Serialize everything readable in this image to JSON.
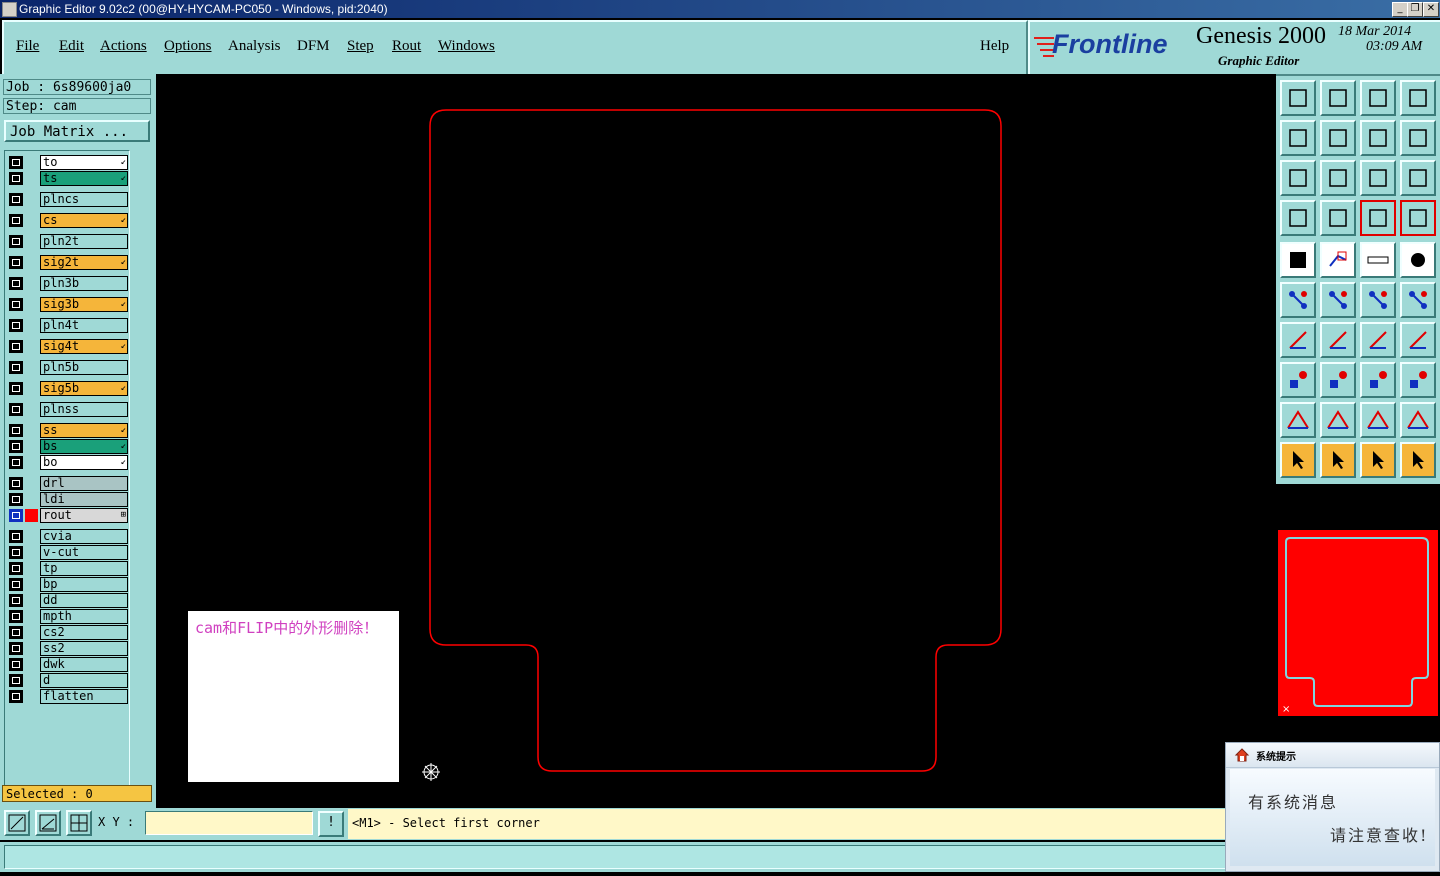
{
  "window": {
    "title": "Graphic Editor 9.02c2 (00@HY-HYCAM-PC050 - Windows, pid:2040)",
    "minimize": "_",
    "restore": "❐",
    "close": "✕"
  },
  "menu": {
    "items": [
      "File",
      "Edit",
      "Actions",
      "Options",
      "Analysis",
      "DFM",
      "Step",
      "Rout",
      "Windows"
    ],
    "help": "Help"
  },
  "brand": {
    "logo": "Frontline",
    "product": "Genesis 2000",
    "subtitle": "Graphic Editor",
    "date": "18 Mar 2014",
    "time": "03:09 AM"
  },
  "job": {
    "job_label": "Job : 6s89600ja0",
    "step_label": "Step: cam",
    "matrix_button": "Job Matrix ..."
  },
  "layers": [
    {
      "name": "to",
      "color": "#ffffff",
      "mark": "↙"
    },
    {
      "name": "ts",
      "color": "#1aa07a",
      "mark": "↙"
    },
    {
      "name": "plncs",
      "color": "#9fd9d6",
      "mark": ""
    },
    {
      "name": "cs",
      "color": "#f5b53a",
      "mark": "↙"
    },
    {
      "name": "pln2t",
      "color": "#9fd9d6",
      "mark": ""
    },
    {
      "name": "sig2t",
      "color": "#f5b53a",
      "mark": "↙"
    },
    {
      "name": "pln3b",
      "color": "#9fd9d6",
      "mark": ""
    },
    {
      "name": "sig3b",
      "color": "#f5b53a",
      "mark": "↙"
    },
    {
      "name": "pln4t",
      "color": "#9fd9d6",
      "mark": ""
    },
    {
      "name": "sig4t",
      "color": "#f5b53a",
      "mark": "↙"
    },
    {
      "name": "pln5b",
      "color": "#9fd9d6",
      "mark": ""
    },
    {
      "name": "sig5b",
      "color": "#f5b53a",
      "mark": "↙"
    },
    {
      "name": "plnss",
      "color": "#9fd9d6",
      "mark": ""
    },
    {
      "name": "ss",
      "color": "#f5b53a",
      "mark": "↙"
    },
    {
      "name": "bs",
      "color": "#1aa07a",
      "mark": "↙"
    },
    {
      "name": "bo",
      "color": "#ffffff",
      "mark": "↙"
    },
    {
      "name": "drl",
      "color": "#a9c4c4",
      "mark": ""
    },
    {
      "name": "ldi",
      "color": "#a9c4c4",
      "mark": ""
    },
    {
      "name": "rout",
      "color": "#d8d8d8",
      "mark": "⊞",
      "active": true
    },
    {
      "name": "cvia",
      "color": "#9fd9d6",
      "mark": ""
    },
    {
      "name": "v-cut",
      "color": "#9fd9d6",
      "mark": ""
    },
    {
      "name": "tp",
      "color": "#9fd9d6",
      "mark": ""
    },
    {
      "name": "bp",
      "color": "#9fd9d6",
      "mark": ""
    },
    {
      "name": "dd",
      "color": "#9fd9d6",
      "mark": ""
    },
    {
      "name": "mpth",
      "color": "#9fd9d6",
      "mark": ""
    },
    {
      "name": "cs2",
      "color": "#9fd9d6",
      "mark": ""
    },
    {
      "name": "ss2",
      "color": "#9fd9d6",
      "mark": ""
    },
    {
      "name": "dwk",
      "color": "#9fd9d6",
      "mark": ""
    },
    {
      "name": "d",
      "color": "#9fd9d6",
      "mark": ""
    },
    {
      "name": "flatten",
      "color": "#9fd9d6",
      "mark": ""
    }
  ],
  "selected": "Selected : 0",
  "note": "cam和FLIP中的外形删除！",
  "coords": {
    "label": "X Y :",
    "value": "",
    "excl": "!"
  },
  "prompt": "<M1> - Select first corner",
  "popup": {
    "title": "系统提示",
    "line1": "有系统消息",
    "line2": "请注意查收!"
  },
  "colors": {
    "panel": "#9fd9d6",
    "outline": "#ff0000",
    "canvas": "#000000"
  }
}
